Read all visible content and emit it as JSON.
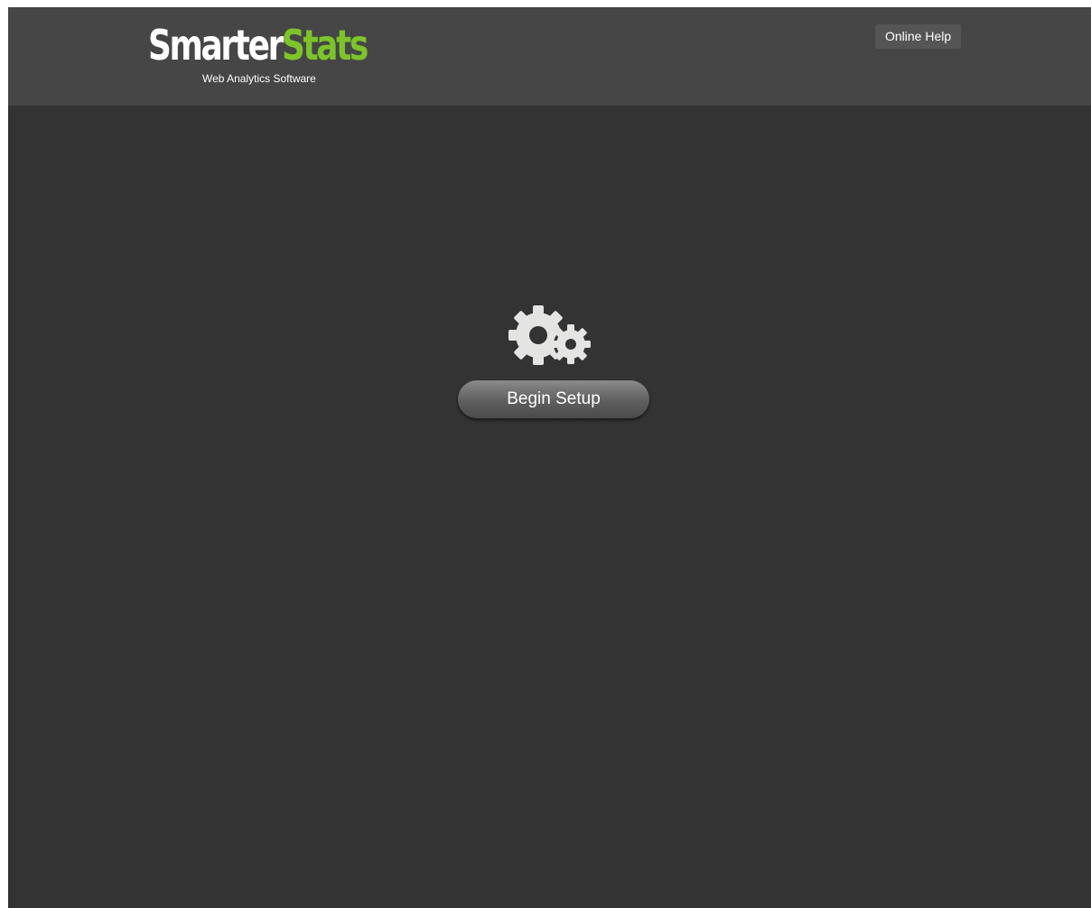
{
  "header": {
    "logo": {
      "word_first": "Smarter",
      "word_second": "Stats",
      "tagline": "Web Analytics Software",
      "colors": {
        "first": "#ffffff",
        "second": "#7dc42a"
      }
    },
    "help_label": "Online Help"
  },
  "main": {
    "icon": "gears-icon",
    "setup_label": "Begin Setup"
  },
  "colors": {
    "background": "#333333",
    "header_background": "#464646",
    "accent": "#7dc42a"
  }
}
